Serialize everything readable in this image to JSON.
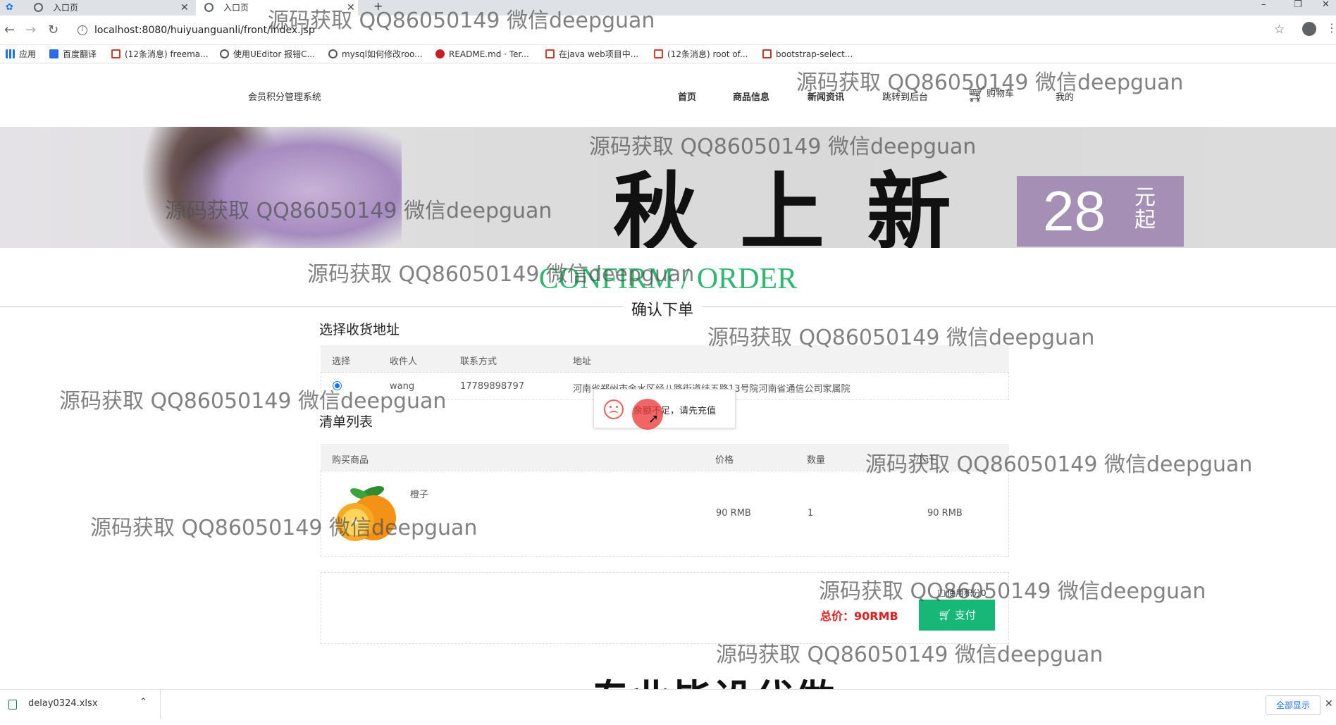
{
  "browser": {
    "tabs": [
      {
        "label": "入口页"
      },
      {
        "label": "入口页"
      }
    ],
    "url": "localhost:8080/huiyuanguanli/front/index.jsp",
    "bookmarks": [
      {
        "label": "应用",
        "color": "#1a73e8"
      },
      {
        "label": "百度翻译",
        "color": "#2b6de8"
      },
      {
        "label": "(12条消息) freema...",
        "color": "#d9392b"
      },
      {
        "label": "使用UEditor 报错C...",
        "color": "#555555"
      },
      {
        "label": "mysql如何修改roo...",
        "color": "#555555"
      },
      {
        "label": "README.md · Ter...",
        "color": "#c71d23"
      },
      {
        "label": "在java web项目中...",
        "color": "#d9392b"
      },
      {
        "label": "(12条消息) root of...",
        "color": "#d9392b"
      },
      {
        "label": "bootstrap-select...",
        "color": "#c0392b"
      }
    ]
  },
  "site": {
    "title": "会员积分管理系统",
    "nav": [
      {
        "label": "首页"
      },
      {
        "label": "商品信息"
      },
      {
        "label": "新闻资讯"
      },
      {
        "label": "跳转到后台"
      },
      {
        "label": "购物车"
      },
      {
        "label": "我的"
      }
    ]
  },
  "banner": {
    "text": "秋上新",
    "price": "28",
    "price_unit": "元起",
    "accent": "#a58fb5"
  },
  "confirm": {
    "title_en": "CONFIRM / ORDER",
    "title_zh": "确认下单",
    "accent": "#2fb671"
  },
  "address": {
    "section_title": "选择收货地址",
    "headers": [
      "选择",
      "收件人",
      "联系方式",
      "地址"
    ],
    "row": {
      "name": "wang",
      "phone": "17789898797",
      "address": "河南省郑州市金水区经八路街道纬五路13号院河南省通信公司家属院"
    }
  },
  "toast": {
    "message": "余额不足，请先充值"
  },
  "list": {
    "section_title": "清单列表",
    "headers": [
      "购买商品",
      "价格",
      "数量",
      "小计"
    ],
    "items": [
      {
        "name": "橙子",
        "price": "90 RMB",
        "qty": "1",
        "subtotal": "90 RMB"
      }
    ]
  },
  "payment": {
    "use_points_label": "使用积分0",
    "total_label": "总价：90RMB",
    "pay_button": "支付",
    "pay_color": "#16b777",
    "total_color": "#e02020"
  },
  "watermarks": {
    "text": "源码获取 QQ86050149 微信deepguan",
    "big_text": "专业毕设代做"
  },
  "downloads": {
    "file": "delay0324.xlsx",
    "show_all": "全部显示"
  }
}
